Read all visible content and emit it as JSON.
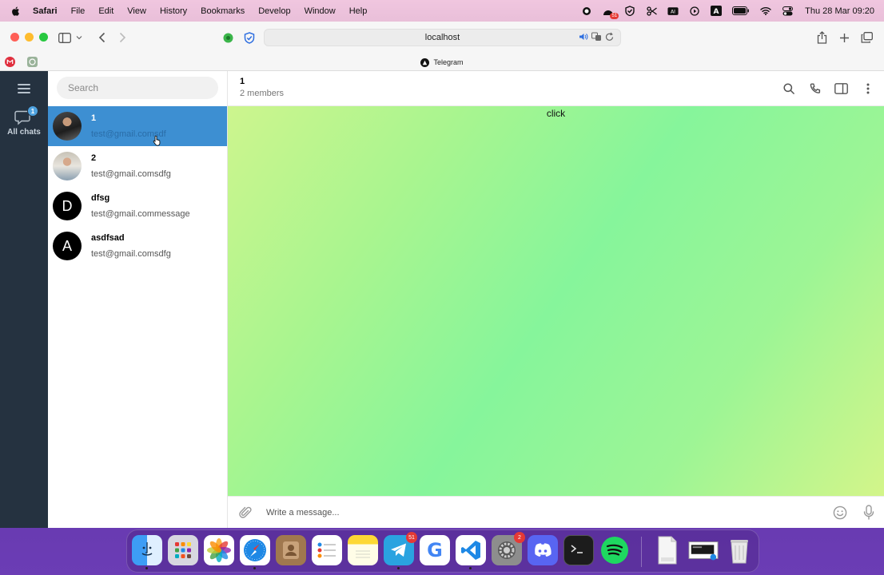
{
  "menubar": {
    "app_name": "Safari",
    "items": [
      "File",
      "Edit",
      "View",
      "History",
      "Bookmarks",
      "Develop",
      "Window",
      "Help"
    ],
    "status_badge": "51",
    "clock": "Thu 28 Mar  09:20",
    "status_icons": [
      "record-icon",
      "dashboard-icon",
      "shield-icon",
      "scissors-icon",
      "ai-icon",
      "play-icon",
      "input-source-a-icon",
      "battery-icon",
      "wifi-icon",
      "control-center-icon"
    ]
  },
  "safari": {
    "address": "localhost",
    "tab_title": "Telegram",
    "toolbar_icons": [
      "sidebar-icon",
      "back-icon",
      "forward-icon",
      "share-icon",
      "new-tab-icon",
      "tab-overview-icon"
    ]
  },
  "telegram": {
    "rail": {
      "folder_label": "All chats",
      "folder_badge": "1"
    },
    "search": {
      "placeholder": "Search"
    },
    "chats": [
      {
        "name": "1",
        "preview": "test@gmail.comsdf",
        "avatar": "photo",
        "active": true
      },
      {
        "name": "2",
        "preview": "test@gmail.comsdfg",
        "avatar": "photo",
        "active": false
      },
      {
        "name": "dfsg",
        "preview": "test@gmail.commessage",
        "avatar": "D",
        "active": false
      },
      {
        "name": "asdfsad",
        "preview": "test@gmail.comsdfg",
        "avatar": "A",
        "active": false
      }
    ],
    "header": {
      "title": "1",
      "subtitle": "2 members"
    },
    "message_area": {
      "label": "click"
    },
    "composer": {
      "placeholder": "Write a message..."
    },
    "colors": {
      "rail": "#253240",
      "active_chat": "#3d8fd2",
      "badge": "#4fa3e0"
    }
  },
  "dock": {
    "apps": [
      {
        "name": "finder",
        "badge": ""
      },
      {
        "name": "launchpad",
        "badge": ""
      },
      {
        "name": "photos",
        "badge": ""
      },
      {
        "name": "safari",
        "badge": ""
      },
      {
        "name": "contacts",
        "badge": ""
      },
      {
        "name": "reminders",
        "badge": ""
      },
      {
        "name": "notes",
        "badge": ""
      },
      {
        "name": "telegram",
        "badge": "51"
      },
      {
        "name": "chrome",
        "badge": ""
      },
      {
        "name": "vscode",
        "badge": ""
      },
      {
        "name": "system-settings",
        "badge": "2"
      },
      {
        "name": "discord",
        "badge": ""
      },
      {
        "name": "terminal",
        "badge": ""
      },
      {
        "name": "spotify",
        "badge": ""
      },
      {
        "name": "html-file",
        "badge": ""
      },
      {
        "name": "screenshot-preview",
        "badge": ""
      },
      {
        "name": "trash",
        "badge": ""
      }
    ]
  }
}
